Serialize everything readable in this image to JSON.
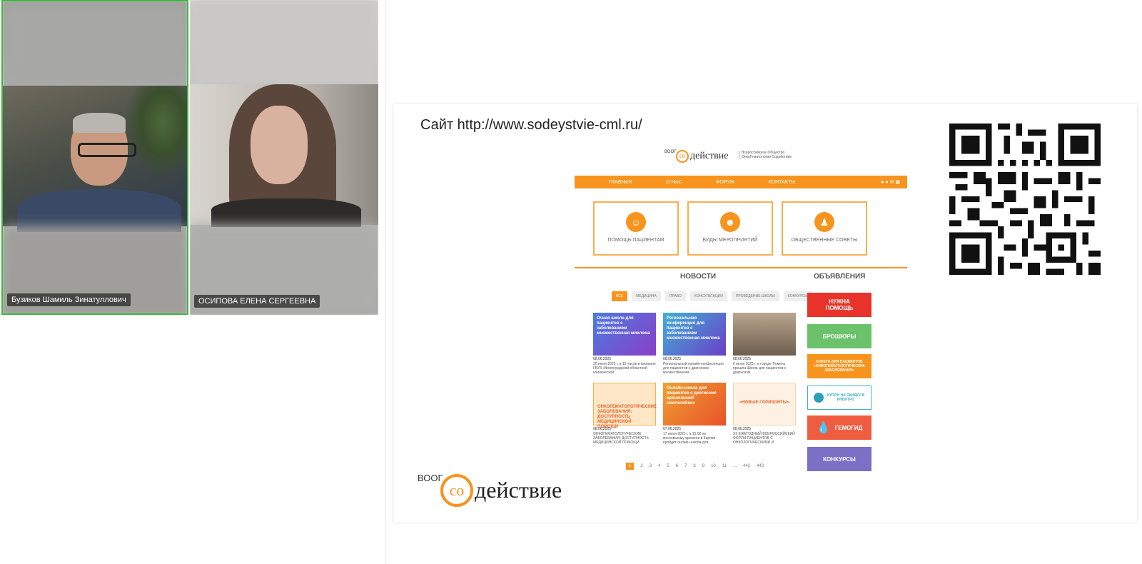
{
  "participants": [
    {
      "name": "Бузиков Шамиль Зинатуллович",
      "active_speaker": true
    },
    {
      "name": "ОСИПОВА ЕЛЕНА СЕРГЕЕВНА",
      "active_speaker": false
    }
  ],
  "slide": {
    "title": "Сайт http://www.sodeystvie-cml.ru/",
    "site": {
      "header_prefix": "ВООГ",
      "header_brand": "действие",
      "header_org": "Всероссийское Общество ОнкоГематологии Содействие",
      "nav": [
        "ГЛАВНАЯ",
        "О НАС",
        "ФОРУМ",
        "КОНТАКТЫ"
      ],
      "categories": [
        "ПОМОЩЬ ПАЦИЕНТАМ",
        "ВИДЫ МЕРОПРИЯТИЙ",
        "ОБЩЕСТВЕННЫЕ СОВЕТЫ"
      ],
      "news_heading": "НОВОСТИ",
      "ads_heading": "ОБЪЯВЛЕНИЯ",
      "filters": [
        "ВСЕ",
        "МЕДИЦИНА",
        "ПРАВО",
        "КОНСУЛЬТАЦИИ",
        "ПРОВЕДЕНИЕ ШКОЛЫ",
        "КОНКУРСЫ"
      ],
      "news_cards": [
        {
          "title": "Очная школа для пациентов с заболеванием множественная миелома",
          "date": "08.06.2025",
          "text": "20 июня 2025 г. в 15 часов в филиале ГБУЗ «Волгоградской областной клинической",
          "color": "#6b3fb8"
        },
        {
          "title": "Региональная конференция для пациентов с заболеванием множественная миелома",
          "date": "08.06.2025",
          "text": "Региональный онлайн-конференция для пациентов с диагнозом множественная",
          "color": "#5a3db0"
        },
        {
          "title": "",
          "date": "08.06.2025",
          "text": "6 июня 2025 г. в городе Тюмень прошла Школа для пациентов с диагнозом",
          "color": "#8a7a6a"
        },
        {
          "title": "ОНКОГЕМАТОЛОГИЧЕСКИЕ ЗАБОЛЕВАНИЯ: ДОСТУПНОСТЬ МЕДИЦИНСКОЙ ПОМОЩИ",
          "date": "08.06.2025",
          "text": "ОНКОГЕМАТОЛОГИЧЕСКИЕ ЗАБОЛЕВАНИЯ: ДОСТУПНОСТЬ МЕДИЦИНСКОЙ ПОМОЩИ",
          "color": "#fde7c7"
        },
        {
          "title": "Онлайн-школа для пациентов с диагнозом хронический миелолейкоз",
          "date": "07.06.2025",
          "text": "17 июня 2025 г. в 15:00 по московскому времени в Кирове пройдет онлайн-школа для",
          "color": "#e8652a"
        },
        {
          "title": "«НОВЫЕ ГОРИЗОНТЫ»",
          "date": "08.06.2025",
          "text": "XII ЕЖЕГОДНЫЙ ВСЕРОССИЙСКИЙ ФОРУМ ПАЦИЕНТОВ С ОНКОЛОГИЧЕСКИМИ И",
          "color": "#fdf1e3"
        }
      ],
      "side_buttons": [
        {
          "label": "НУЖНА ПОМОЩЬ",
          "color": "#e8332a"
        },
        {
          "label": "БРОШЮРЫ",
          "color": "#6cc26a"
        },
        {
          "label": "АНКЕТА ДЛЯ ПАЦИЕНТОВ «ОНКОГЕМАТОЛОГИЧЕСКИЕ ЗАБОЛЕВАНИЯ»",
          "color": "#f7941d"
        },
        {
          "label": "КУПОН НА СКИДКУ В ИНВИТРО",
          "color": "#ffffff"
        },
        {
          "label": "ГЕМОГИД",
          "color": "#ee5d3f"
        },
        {
          "label": "КОНКУРСЫ",
          "color": "#7b6fc6"
        }
      ],
      "pages": [
        "1",
        "2",
        "3",
        "4",
        "5",
        "6",
        "7",
        "8",
        "9",
        "10",
        "11",
        "...",
        "442",
        "443"
      ],
      "current_page": "1"
    },
    "logo_prefix": "ВООГ",
    "logo_brand": "действие",
    "colors": {
      "orange": "#f7941d",
      "active_speaker_border": "#3db83d"
    }
  }
}
